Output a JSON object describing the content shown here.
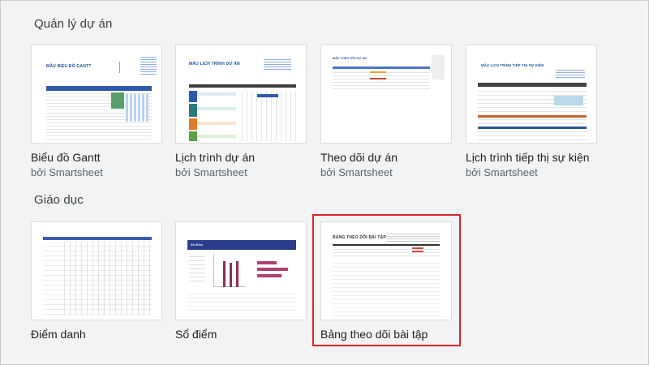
{
  "sections": [
    {
      "title": "Quản lý dự án",
      "templates": [
        {
          "title": "Biểu đồ Gantt",
          "author": "bởi Smartsheet",
          "thumb_heading": "MẪU BIỂU ĐỒ GANTT"
        },
        {
          "title": "Lịch trình dự án",
          "author": "bởi Smartsheet",
          "thumb_heading": "MẪU LỊCH TRÌNH DỰ ÁN"
        },
        {
          "title": "Theo dõi dự án",
          "author": "bởi Smartsheet",
          "thumb_heading": "MẪU THEO DÕI DỰ ÁN"
        },
        {
          "title": "Lịch trình tiếp thị sự kiện",
          "author": "bởi Smartsheet",
          "thumb_heading": "MẪU LỊCH TRÌNH TIẾP THỊ SỰ KIỆN"
        }
      ]
    },
    {
      "title": "Giáo dục",
      "templates": [
        {
          "title": "Điểm danh"
        },
        {
          "title": "Sổ điểm",
          "thumb_heading": "Sổ điểm"
        },
        {
          "title": "Bảng theo dõi bài tập",
          "thumb_heading": "BẢNG THEO DÕI BÀI TẬP",
          "highlighted": true
        }
      ]
    }
  ],
  "colors": {
    "background": "#f1f3f4",
    "highlight_border": "#d6262b",
    "smartsheet_blue": "#1f4e9b"
  }
}
